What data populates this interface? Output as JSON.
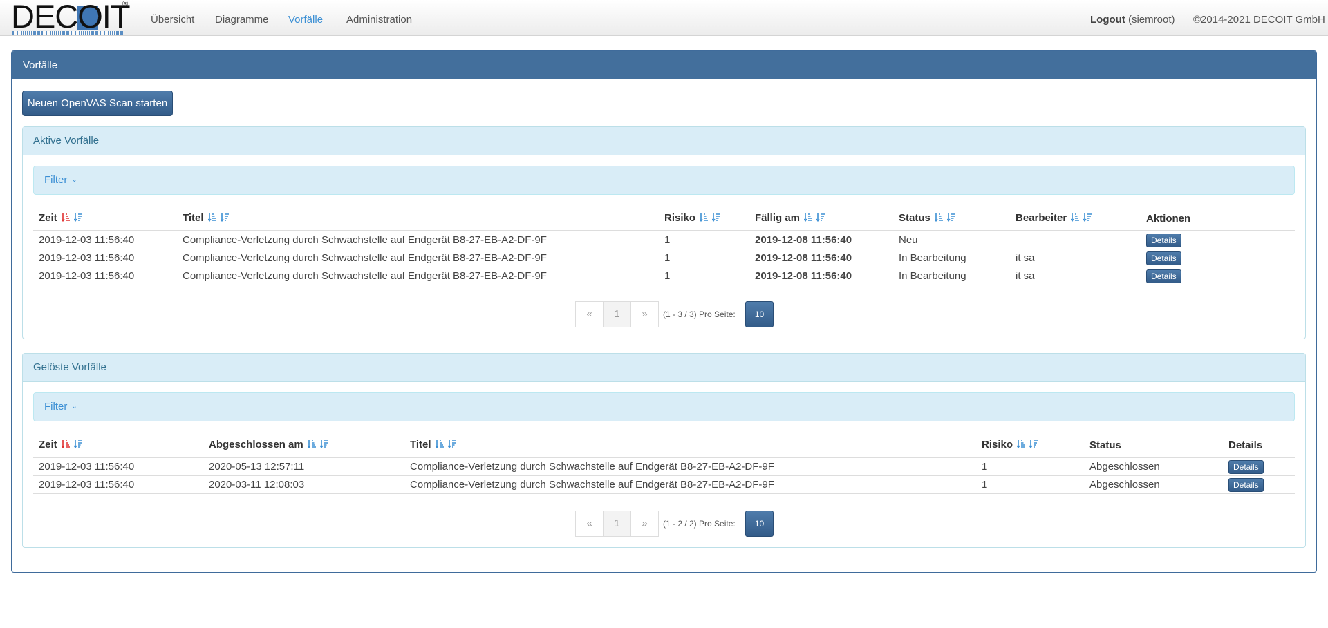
{
  "brand": {
    "logo_text": "DECOIT",
    "registered": "®"
  },
  "nav": {
    "items": [
      {
        "label": "Übersicht"
      },
      {
        "label": "Diagramme"
      },
      {
        "label": "Vorfälle"
      },
      {
        "label": "Administration"
      }
    ],
    "active": "Vorfälle",
    "logout_label": "Logout",
    "user": "(siemroot)",
    "copyright": "©2014-2021 DECOIT GmbH"
  },
  "colors": {
    "header_blue": "#436f9c",
    "due_red": "#e00000",
    "active_link": "#3b8fd4",
    "sort_icon_active": "#e03030"
  },
  "main": {
    "title": "Vorfälle",
    "scan_button": "Neuen OpenVAS Scan starten",
    "active_panel": {
      "title": "Aktive Vorfälle",
      "filter_label": "Filter",
      "columns": [
        "Zeit",
        "Titel",
        "Risiko",
        "Fällig am",
        "Status",
        "Bearbeiter",
        "Aktionen"
      ],
      "rows": [
        {
          "zeit": "2019-12-03 11:56:40",
          "titel": "Compliance-Verletzung durch Schwachstelle auf Endgerät B8-27-EB-A2-DF-9F",
          "risiko": "1",
          "faellig": "2019-12-08 11:56:40",
          "status": "Neu",
          "bearbeiter": "",
          "action": "Details"
        },
        {
          "zeit": "2019-12-03 11:56:40",
          "titel": "Compliance-Verletzung durch Schwachstelle auf Endgerät B8-27-EB-A2-DF-9F",
          "risiko": "1",
          "faellig": "2019-12-08 11:56:40",
          "status": "In Bearbeitung",
          "bearbeiter": "it sa",
          "action": "Details"
        },
        {
          "zeit": "2019-12-03 11:56:40",
          "titel": "Compliance-Verletzung durch Schwachstelle auf Endgerät B8-27-EB-A2-DF-9F",
          "risiko": "1",
          "faellig": "2019-12-08 11:56:40",
          "status": "In Bearbeitung",
          "bearbeiter": "it sa",
          "action": "Details"
        }
      ],
      "pager": {
        "prev": "«",
        "page": "1",
        "next": "»",
        "info": "(1 - 3 / 3) Pro Seite:",
        "page_size": "10"
      }
    },
    "resolved_panel": {
      "title": "Gelöste Vorfälle",
      "filter_label": "Filter",
      "columns": [
        "Zeit",
        "Abgeschlossen am",
        "Titel",
        "Risiko",
        "Status",
        "Details"
      ],
      "rows": [
        {
          "zeit": "2019-12-03 11:56:40",
          "abgeschlossen": "2020-05-13 12:57:11",
          "titel": "Compliance-Verletzung durch Schwachstelle auf Endgerät B8-27-EB-A2-DF-9F",
          "risiko": "1",
          "status": "Abgeschlossen",
          "action": "Details"
        },
        {
          "zeit": "2019-12-03 11:56:40",
          "abgeschlossen": "2020-03-11 12:08:03",
          "titel": "Compliance-Verletzung durch Schwachstelle auf Endgerät B8-27-EB-A2-DF-9F",
          "risiko": "1",
          "status": "Abgeschlossen",
          "action": "Details"
        }
      ],
      "pager": {
        "prev": "«",
        "page": "1",
        "next": "»",
        "info": "(1 - 2 / 2) Pro Seite:",
        "page_size": "10"
      }
    }
  }
}
